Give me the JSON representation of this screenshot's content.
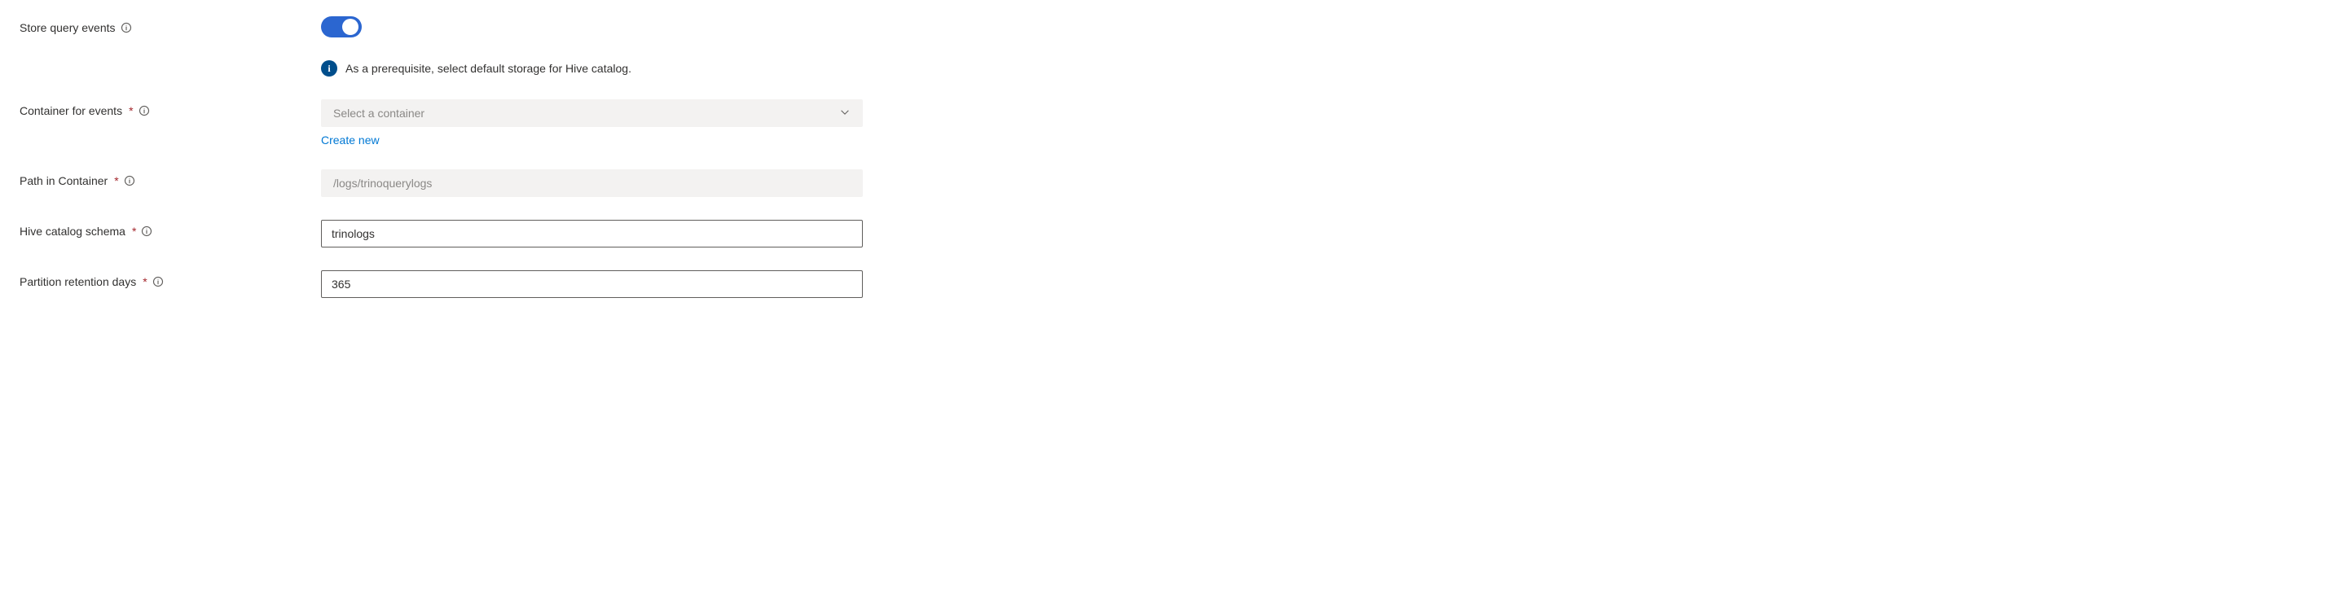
{
  "labels": {
    "store_query_events": "Store query events",
    "container_for_events": "Container for events",
    "path_in_container": "Path in Container",
    "hive_catalog_schema": "Hive catalog schema",
    "partition_retention_days": "Partition retention days"
  },
  "notice": {
    "icon_text": "i",
    "text": "As a prerequisite, select default storage for Hive catalog."
  },
  "container": {
    "placeholder": "Select a container",
    "create_new": "Create new"
  },
  "path": {
    "placeholder": "/logs/trinoquerylogs"
  },
  "schema": {
    "value": "trinologs"
  },
  "retention": {
    "value": "365"
  }
}
